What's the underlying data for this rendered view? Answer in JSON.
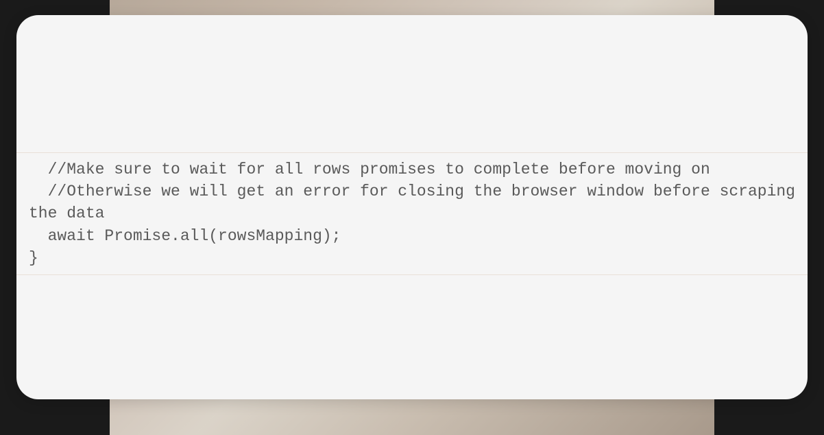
{
  "code": {
    "content": "  //Make sure to wait for all rows promises to complete before moving on\n  //Otherwise we will get an error for closing the browser window before scraping the data\n  await Promise.all(rowsMapping);\n}"
  }
}
